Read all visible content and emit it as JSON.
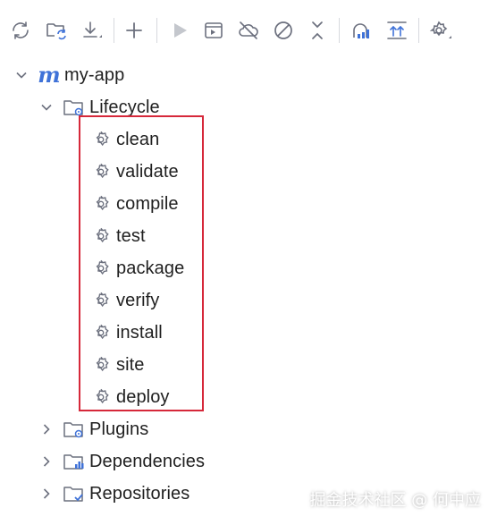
{
  "toolbar": {
    "buttons": [
      {
        "name": "reload-icon"
      },
      {
        "name": "reload-projects-icon"
      },
      {
        "name": "download-icon"
      },
      {
        "name": "add-icon"
      },
      {
        "name": "run-icon"
      },
      {
        "name": "execute-goal-icon"
      },
      {
        "name": "offline-icon"
      },
      {
        "name": "skip-tests-icon"
      },
      {
        "name": "collapse-icon"
      },
      {
        "name": "analyze-dependencies-icon"
      },
      {
        "name": "expand-all-icon"
      },
      {
        "name": "settings-icon"
      }
    ]
  },
  "tree": {
    "project": "my-app",
    "lifecycle": "Lifecycle",
    "phases": [
      "clean",
      "validate",
      "compile",
      "test",
      "package",
      "verify",
      "install",
      "site",
      "deploy"
    ],
    "plugins": "Plugins",
    "dependencies": "Dependencies",
    "repositories": "Repositories"
  },
  "colors": {
    "highlight": "#d6283a",
    "icon": "#6c707e",
    "accent": "#3f72d8"
  },
  "watermark": "掘金技术社区 @ 何中应"
}
